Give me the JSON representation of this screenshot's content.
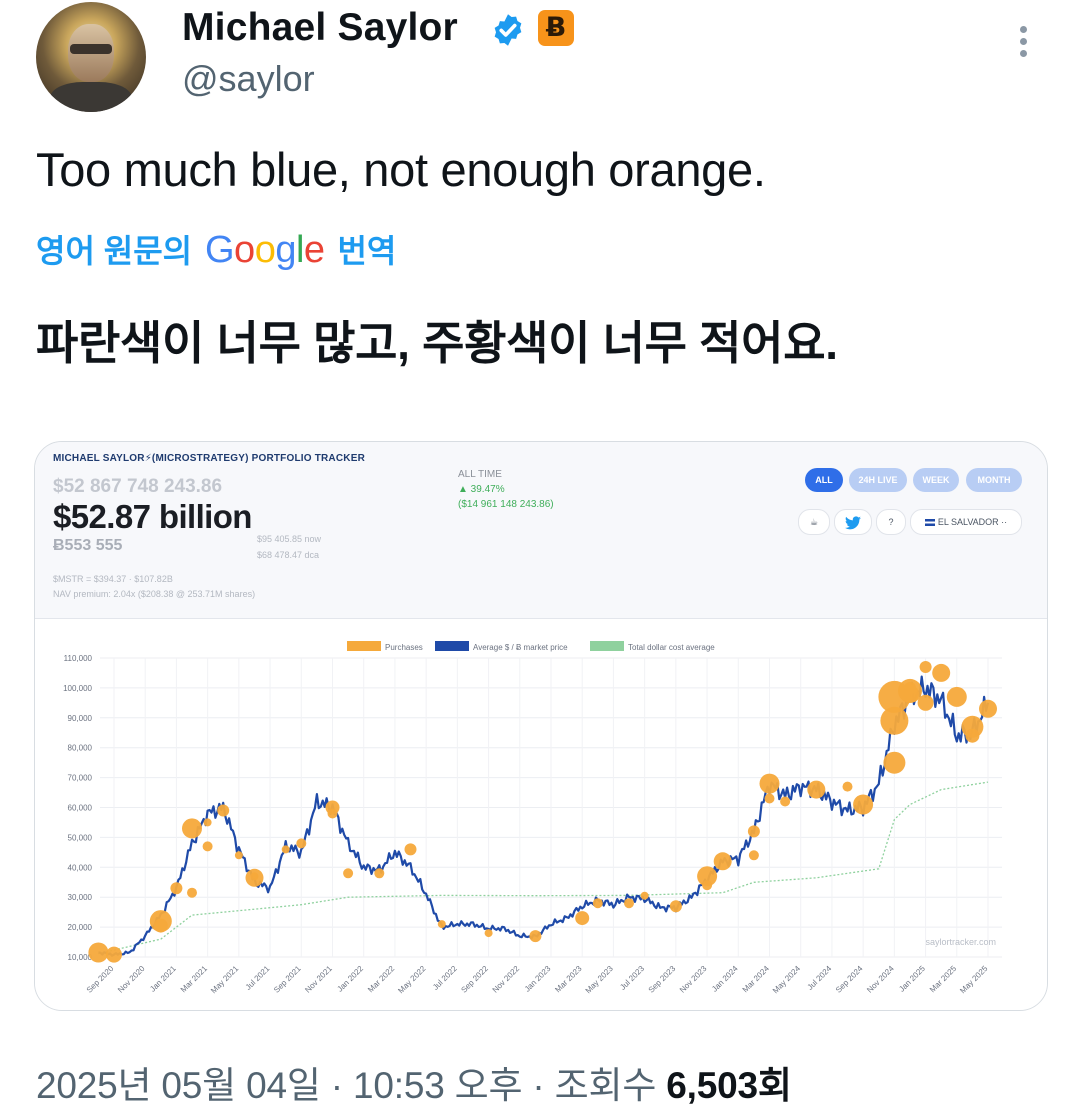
{
  "tweet": {
    "author_name": "Michael Saylor",
    "handle": "@saylor",
    "badge_symbol": "Ƀ",
    "text": "Too much blue, not enough orange.",
    "translate_prefix": "영어 원문의",
    "translate_brand": [
      "G",
      "o",
      "o",
      "g",
      "l",
      "e"
    ],
    "translate_suffix": "번역",
    "translated_text": "파란색이 너무 많고, 주황색이 너무 적어요.",
    "timestamp": "2025년 05월 04일 · 10:53 오후 ·",
    "views_label": "조회수",
    "views_count": "6,503회",
    "colors": {
      "verified": "#1d9bf0",
      "btc_badge": "#f7931a",
      "link": "#1d9bf0"
    }
  },
  "tracker": {
    "title": "MICHAEL SAYLOR⚡(MICROSTRATEGY) PORTFOLIO TRACKER",
    "value_usd_grey": "$52 867 748 243.86",
    "value_usd_big": "$52.87 billion",
    "btc_holdings": "Ƀ553 555",
    "price_now": "$95 405.85 now",
    "price_dca": "$68 478.47 dca",
    "mstr_line": "$MSTR = $394.37 · $107.82B",
    "nav_line": "NAV premium: 2.04x ($208.38 @ 253.71M shares)",
    "all_time_label": "ALL TIME",
    "all_time_pct": "▲ 39.47%",
    "all_time_gain": "($14 961 148 243.86)",
    "tabs": [
      "ALL",
      "24H LIVE",
      "WEEK",
      "MONTH"
    ],
    "active_tab": "ALL",
    "chips": [
      "☕",
      "🐦",
      "?",
      "EL SALVADOR ··"
    ]
  },
  "chart_data": {
    "type": "line",
    "legend": [
      "Purchases",
      "Average $ / Ƀ market price",
      "Total dollar cost average"
    ],
    "legend_placement": "top-center",
    "watermark": "saylortracker.com",
    "y_ticks": [
      "110,000",
      "100,000",
      "90,000",
      "80,000",
      "70,000",
      "60,000",
      "50,000",
      "40,000",
      "30,000",
      "20,000",
      "10,000"
    ],
    "ylim": [
      10000,
      110000
    ],
    "x_ticks": [
      "Sep 2020",
      "Nov 2020",
      "Jan 2021",
      "Mar 2021",
      "May 2021",
      "Jul 2021",
      "Sep 2021",
      "Nov 2021",
      "Jan 2022",
      "Mar 2022",
      "May 2022",
      "Jul 2022",
      "Sep 2022",
      "Nov 2022",
      "Jan 2023",
      "Mar 2023",
      "May 2023",
      "Jul 2023",
      "Sep 2023",
      "Nov 2023",
      "Jan 2024",
      "Mar 2024",
      "May 2024",
      "Jul 2024",
      "Sep 2024",
      "Nov 2024",
      "Jan 2025",
      "Mar 2025",
      "May 2025"
    ],
    "grid": true,
    "colors": {
      "price": "#1f4aa8",
      "purchase": "#f5a93b",
      "dca": "#8fd19e"
    },
    "series": [
      {
        "name": "Average $ / Ƀ market price",
        "x": [
          "2020-08",
          "2020-09",
          "2020-10",
          "2020-11",
          "2020-12",
          "2021-01",
          "2021-02",
          "2021-03",
          "2021-04",
          "2021-05",
          "2021-06",
          "2021-07",
          "2021-08",
          "2021-09",
          "2021-10",
          "2021-11",
          "2021-12",
          "2022-01",
          "2022-02",
          "2022-03",
          "2022-04",
          "2022-05",
          "2022-06",
          "2022-07",
          "2022-08",
          "2022-09",
          "2022-10",
          "2022-11",
          "2022-12",
          "2023-01",
          "2023-02",
          "2023-03",
          "2023-04",
          "2023-05",
          "2023-06",
          "2023-07",
          "2023-08",
          "2023-09",
          "2023-10",
          "2023-11",
          "2023-12",
          "2024-01",
          "2024-02",
          "2024-03",
          "2024-04",
          "2024-05",
          "2024-06",
          "2024-07",
          "2024-08",
          "2024-09",
          "2024-10",
          "2024-11",
          "2024-12",
          "2025-01",
          "2025-02",
          "2025-03",
          "2025-04",
          "2025-05"
        ],
        "values": [
          11500,
          10800,
          11500,
          17000,
          24000,
          33000,
          48000,
          58000,
          60000,
          46000,
          35000,
          33000,
          47000,
          45000,
          62000,
          60000,
          48000,
          40000,
          39000,
          45000,
          40000,
          31000,
          20000,
          21000,
          21000,
          19500,
          19500,
          17000,
          16800,
          21000,
          23000,
          27000,
          29000,
          27500,
          30000,
          29500,
          26500,
          26500,
          30000,
          36000,
          42000,
          43000,
          52000,
          68000,
          64000,
          67000,
          66000,
          62000,
          59000,
          60000,
          68000,
          88000,
          97000,
          100000,
          96000,
          84000,
          85000,
          95000
        ]
      },
      {
        "name": "Total dollar cost average",
        "x": [
          "2020-08",
          "2020-12",
          "2021-02",
          "2021-06",
          "2021-09",
          "2021-12",
          "2022-06",
          "2022-12",
          "2023-06",
          "2023-12",
          "2024-02",
          "2024-06",
          "2024-10",
          "2024-11",
          "2024-12",
          "2025-02",
          "2025-05"
        ],
        "values": [
          11100,
          16000,
          24000,
          26000,
          27500,
          30000,
          30600,
          30500,
          30600,
          31500,
          35000,
          36500,
          39500,
          56000,
          61000,
          66000,
          68500
        ]
      },
      {
        "name": "Purchases",
        "x": [
          "2020-08",
          "2020-09",
          "2020-12",
          "2020-12",
          "2021-01",
          "2021-02",
          "2021-02",
          "2021-03",
          "2021-03",
          "2021-04",
          "2021-05",
          "2021-06",
          "2021-06",
          "2021-08",
          "2021-09",
          "2021-11",
          "2021-11",
          "2021-12",
          "2022-02",
          "2022-04",
          "2022-06",
          "2022-09",
          "2022-12",
          "2023-03",
          "2023-04",
          "2023-06",
          "2023-07",
          "2023-09",
          "2023-11",
          "2023-11",
          "2023-12",
          "2024-02",
          "2024-02",
          "2024-03",
          "2024-03",
          "2024-04",
          "2024-06",
          "2024-08",
          "2024-09",
          "2024-11",
          "2024-11",
          "2024-11",
          "2024-12",
          "2024-12",
          "2024-12",
          "2025-01",
          "2025-01",
          "2025-02",
          "2025-03",
          "2025-04",
          "2025-04",
          "2025-05"
        ],
        "values": [
          11500,
          10800,
          22000,
          20500,
          33000,
          31500,
          53000,
          47000,
          55000,
          59000,
          44000,
          37000,
          36500,
          46000,
          48000,
          60000,
          58000,
          38000,
          38000,
          46000,
          21000,
          18000,
          17000,
          23000,
          28000,
          28000,
          30500,
          27000,
          34000,
          37000,
          42000,
          44000,
          52000,
          68000,
          63000,
          62000,
          66000,
          67000,
          61000,
          75000,
          89000,
          97000,
          98000,
          100000,
          99000,
          107000,
          95000,
          105000,
          97000,
          87000,
          84000,
          93000
        ],
        "sizes": [
          10,
          8,
          11,
          7,
          6,
          5,
          10,
          5,
          4,
          6,
          4,
          4,
          9,
          4,
          5,
          7,
          5,
          5,
          5,
          6,
          4,
          4,
          6,
          7,
          5,
          5,
          4,
          6,
          5,
          10,
          9,
          5,
          6,
          10,
          5,
          5,
          9,
          5,
          10,
          11,
          14,
          16,
          9,
          6,
          12,
          6,
          8,
          9,
          10,
          11,
          7,
          9
        ]
      }
    ]
  }
}
